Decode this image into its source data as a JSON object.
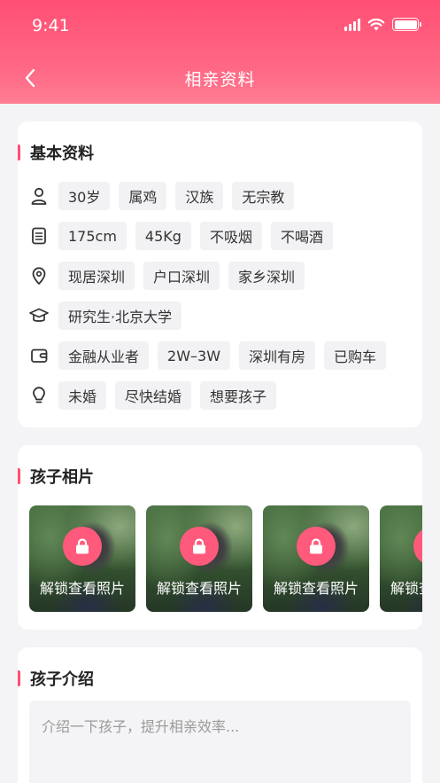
{
  "status_bar": {
    "time": "9:41"
  },
  "nav": {
    "title": "相亲资料"
  },
  "basic": {
    "title": "基本资料",
    "rows": [
      {
        "icon": "person-icon",
        "tags": [
          "30岁",
          "属鸡",
          "汉族",
          "无宗教"
        ]
      },
      {
        "icon": "document-icon",
        "tags": [
          "175cm",
          "45Kg",
          "不吸烟",
          "不喝酒"
        ]
      },
      {
        "icon": "location-pin-icon",
        "tags": [
          "现居深圳",
          "户口深圳",
          "家乡深圳"
        ]
      },
      {
        "icon": "graduation-cap-icon",
        "tags": [
          "研究生·北京大学"
        ]
      },
      {
        "icon": "wallet-icon",
        "tags": [
          "金融从业者",
          "2W–3W",
          "深圳有房",
          "已购车"
        ]
      },
      {
        "icon": "lightbulb-icon",
        "tags": [
          "未婚",
          "尽快结婚",
          "想要孩子"
        ]
      }
    ]
  },
  "photos": {
    "title": "孩子相片",
    "items": [
      {
        "label": "解锁查看照片"
      },
      {
        "label": "解锁查看照片"
      },
      {
        "label": "解锁查看照片"
      },
      {
        "label": "解锁查看照片"
      }
    ]
  },
  "intro": {
    "title": "孩子介绍",
    "placeholder": "介绍一下孩子，提升相亲效率..."
  },
  "colors": {
    "accent": "#ff4f74",
    "lock_bg": "#ff5a7c",
    "tag_bg": "#f2f2f4"
  }
}
